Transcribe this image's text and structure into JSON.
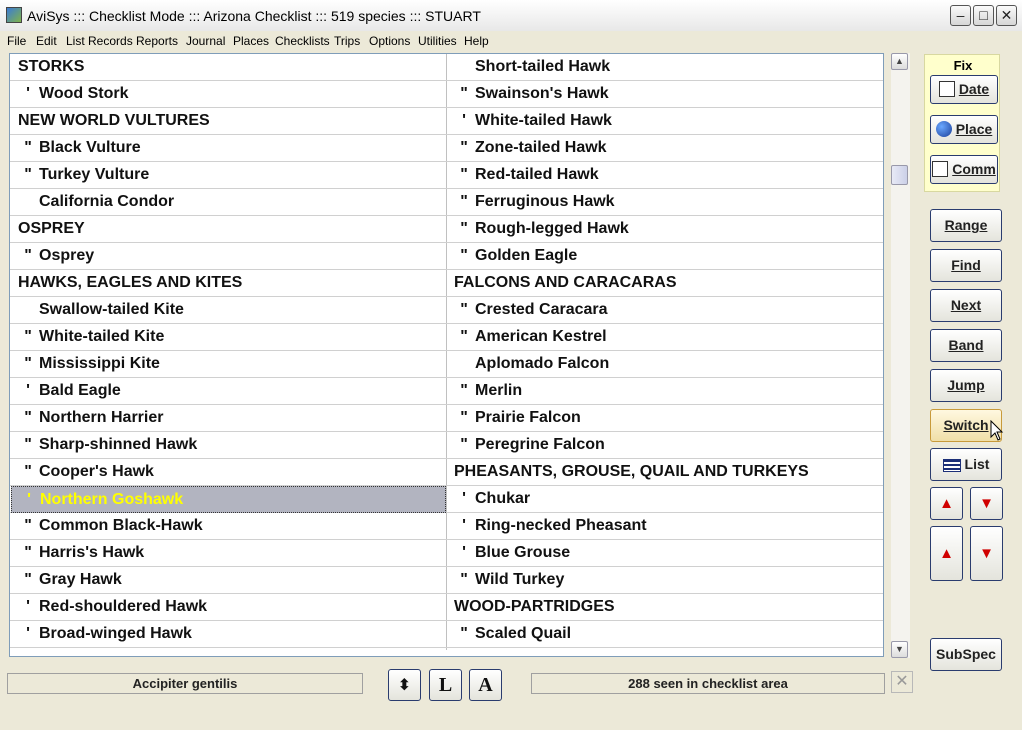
{
  "window": {
    "title": "AviSys ::: Checklist Mode ::: Arizona Checklist ::: 519 species ::: STUART",
    "minimize": "–",
    "maximize": "□",
    "close": "✕"
  },
  "menu": [
    "File",
    "Edit",
    "List Records",
    "Reports",
    "Journal",
    "Places",
    "Checklists",
    "Trips",
    "Options",
    "Utilities",
    "Help"
  ],
  "left_column": [
    {
      "mark": "",
      "text": "STORKS",
      "header": true
    },
    {
      "mark": "'",
      "text": "Wood Stork"
    },
    {
      "mark": "",
      "text": "NEW WORLD VULTURES",
      "header": true
    },
    {
      "mark": "\"",
      "text": "Black Vulture"
    },
    {
      "mark": "\"",
      "text": "Turkey Vulture"
    },
    {
      "mark": "",
      "text": "California Condor"
    },
    {
      "mark": "",
      "text": "OSPREY",
      "header": true
    },
    {
      "mark": "\"",
      "text": "Osprey"
    },
    {
      "mark": "",
      "text": "HAWKS, EAGLES AND KITES",
      "header": true
    },
    {
      "mark": "",
      "text": "Swallow-tailed Kite"
    },
    {
      "mark": "\"",
      "text": "White-tailed Kite"
    },
    {
      "mark": "\"",
      "text": "Mississippi Kite"
    },
    {
      "mark": "'",
      "text": "Bald Eagle"
    },
    {
      "mark": "\"",
      "text": "Northern Harrier"
    },
    {
      "mark": "\"",
      "text": "Sharp-shinned Hawk"
    },
    {
      "mark": "\"",
      "text": "Cooper's Hawk"
    },
    {
      "mark": "'",
      "text": "Northern Goshawk",
      "selected": true
    },
    {
      "mark": "\"",
      "text": "Common Black-Hawk"
    },
    {
      "mark": "\"",
      "text": "Harris's Hawk"
    },
    {
      "mark": "\"",
      "text": "Gray Hawk"
    },
    {
      "mark": "'",
      "text": "Red-shouldered Hawk"
    },
    {
      "mark": "'",
      "text": "Broad-winged Hawk"
    }
  ],
  "right_column": [
    {
      "mark": "",
      "text": "Short-tailed Hawk"
    },
    {
      "mark": "\"",
      "text": "Swainson's Hawk"
    },
    {
      "mark": "'",
      "text": "White-tailed Hawk"
    },
    {
      "mark": "\"",
      "text": "Zone-tailed Hawk"
    },
    {
      "mark": "\"",
      "text": "Red-tailed Hawk"
    },
    {
      "mark": "\"",
      "text": "Ferruginous Hawk"
    },
    {
      "mark": "\"",
      "text": "Rough-legged Hawk"
    },
    {
      "mark": "\"",
      "text": "Golden Eagle"
    },
    {
      "mark": "",
      "text": "FALCONS AND CARACARAS",
      "header": true
    },
    {
      "mark": "\"",
      "text": "Crested Caracara"
    },
    {
      "mark": "\"",
      "text": "American Kestrel"
    },
    {
      "mark": "",
      "text": "Aplomado Falcon"
    },
    {
      "mark": "\"",
      "text": "Merlin"
    },
    {
      "mark": "\"",
      "text": "Prairie Falcon"
    },
    {
      "mark": "\"",
      "text": "Peregrine Falcon"
    },
    {
      "mark": "",
      "text": "PHEASANTS, GROUSE, QUAIL AND TURKEYS",
      "header": true
    },
    {
      "mark": "'",
      "text": "Chukar"
    },
    {
      "mark": "'",
      "text": "Ring-necked Pheasant"
    },
    {
      "mark": "'",
      "text": "Blue Grouse"
    },
    {
      "mark": "\"",
      "text": "Wild Turkey"
    },
    {
      "mark": "",
      "text": "WOOD-PARTRIDGES",
      "header": true
    },
    {
      "mark": "\"",
      "text": "Scaled Quail"
    }
  ],
  "fix_panel": {
    "label": "Fix",
    "date": "Date",
    "place": "Place",
    "comm": "Comm"
  },
  "side_buttons": {
    "range": "Range",
    "find": "Find",
    "next": "Next",
    "band": "Band",
    "jump": "Jump",
    "switch": "Switch",
    "list": "List",
    "subspec": "SubSpec"
  },
  "status": {
    "scientific_name": "Accipiter gentilis",
    "seen_count": "288 seen in checklist area"
  },
  "toolbar": {
    "sort_label": "⬍",
    "l_label": "L",
    "a_label": "A"
  },
  "colors": {
    "selection_bg": "#b2b4c0",
    "selection_text": "#ffff00",
    "arrow": "#d00000"
  }
}
